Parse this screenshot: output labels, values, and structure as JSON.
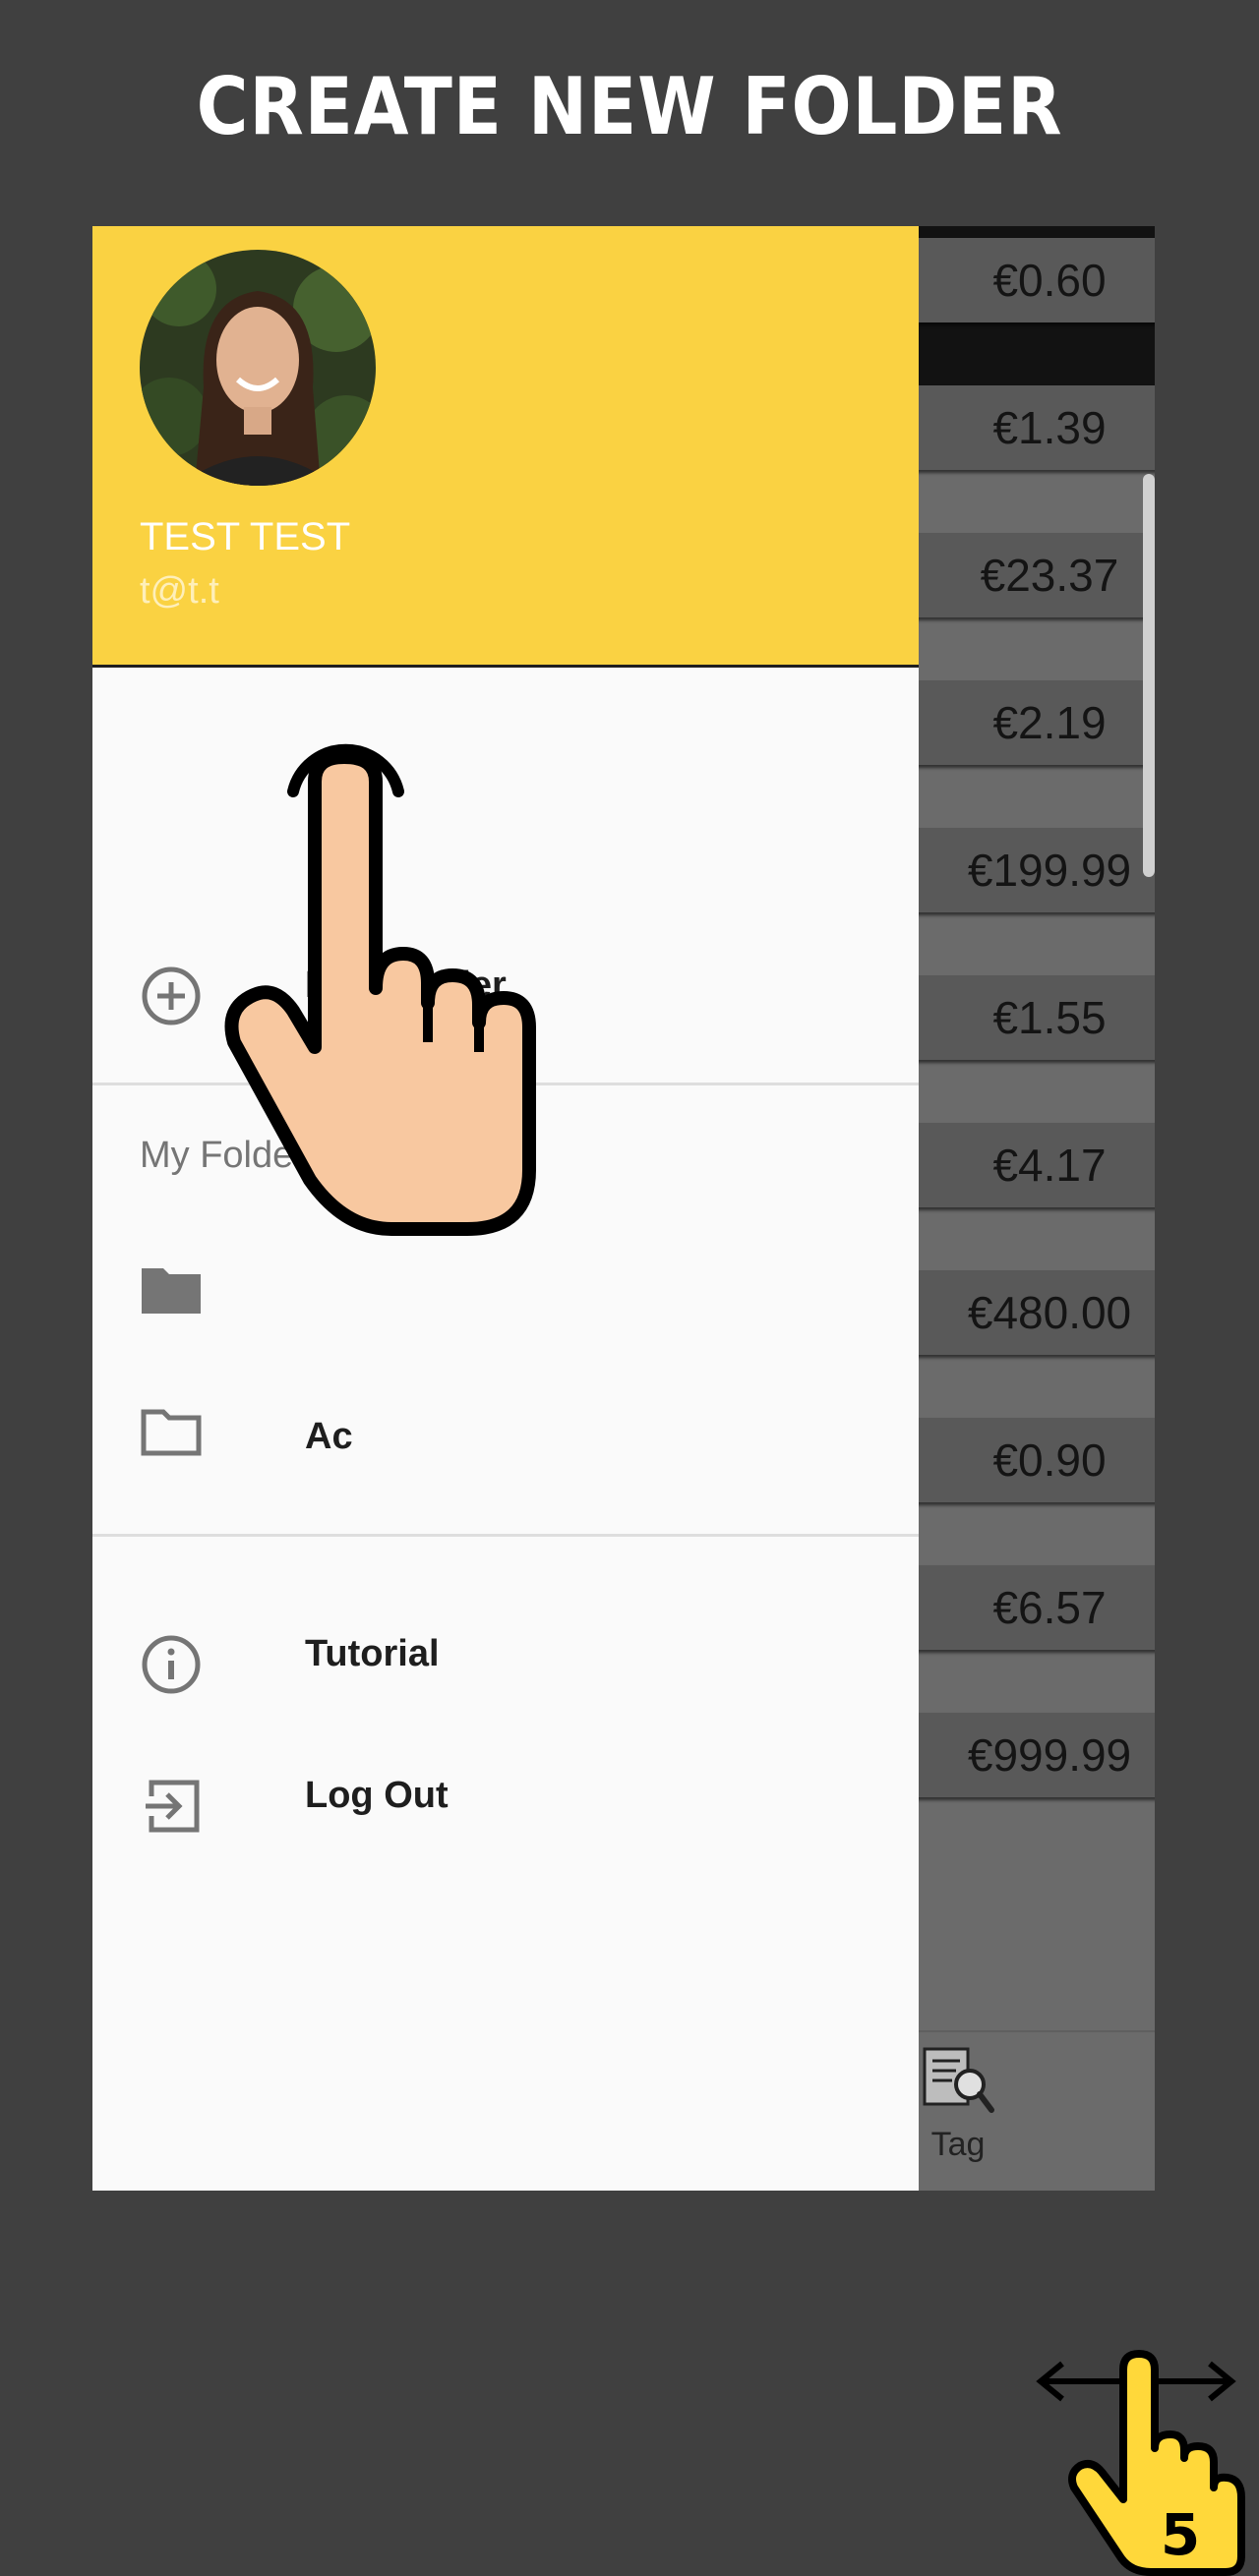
{
  "banner": {
    "title": "CREATE NEW FOLDER"
  },
  "background_list": {
    "prices": [
      "€0.60",
      "€1.39",
      "€23.37",
      "€2.19",
      "€199.99",
      "€1.55",
      "€4.17",
      "€480.00",
      "€0.90",
      "€6.57",
      "€999.99"
    ],
    "bottom_tab": {
      "label": "Tag",
      "icon": "tag-search-icon"
    }
  },
  "drawer": {
    "header": {
      "name": "TEST TEST",
      "email": "t@t.t",
      "background_color": "#fad242",
      "avatar": "avatar"
    },
    "new_folder": {
      "label": "New Folder",
      "icon": "add-circle-icon"
    },
    "section_title": "My Folders",
    "folders": [
      {
        "label": "",
        "icon": "folder-filled-icon"
      },
      {
        "label": "Ac",
        "icon": "folder-outline-icon"
      }
    ],
    "menu": [
      {
        "label": "Tutorial",
        "icon": "info-icon"
      },
      {
        "label": "Log Out",
        "icon": "log-out-icon"
      }
    ]
  },
  "overlays": {
    "tap_hand": "tap-hand-icon",
    "swipe_hint": "swipe-hint-icon",
    "swipe_hint_number": "5"
  }
}
